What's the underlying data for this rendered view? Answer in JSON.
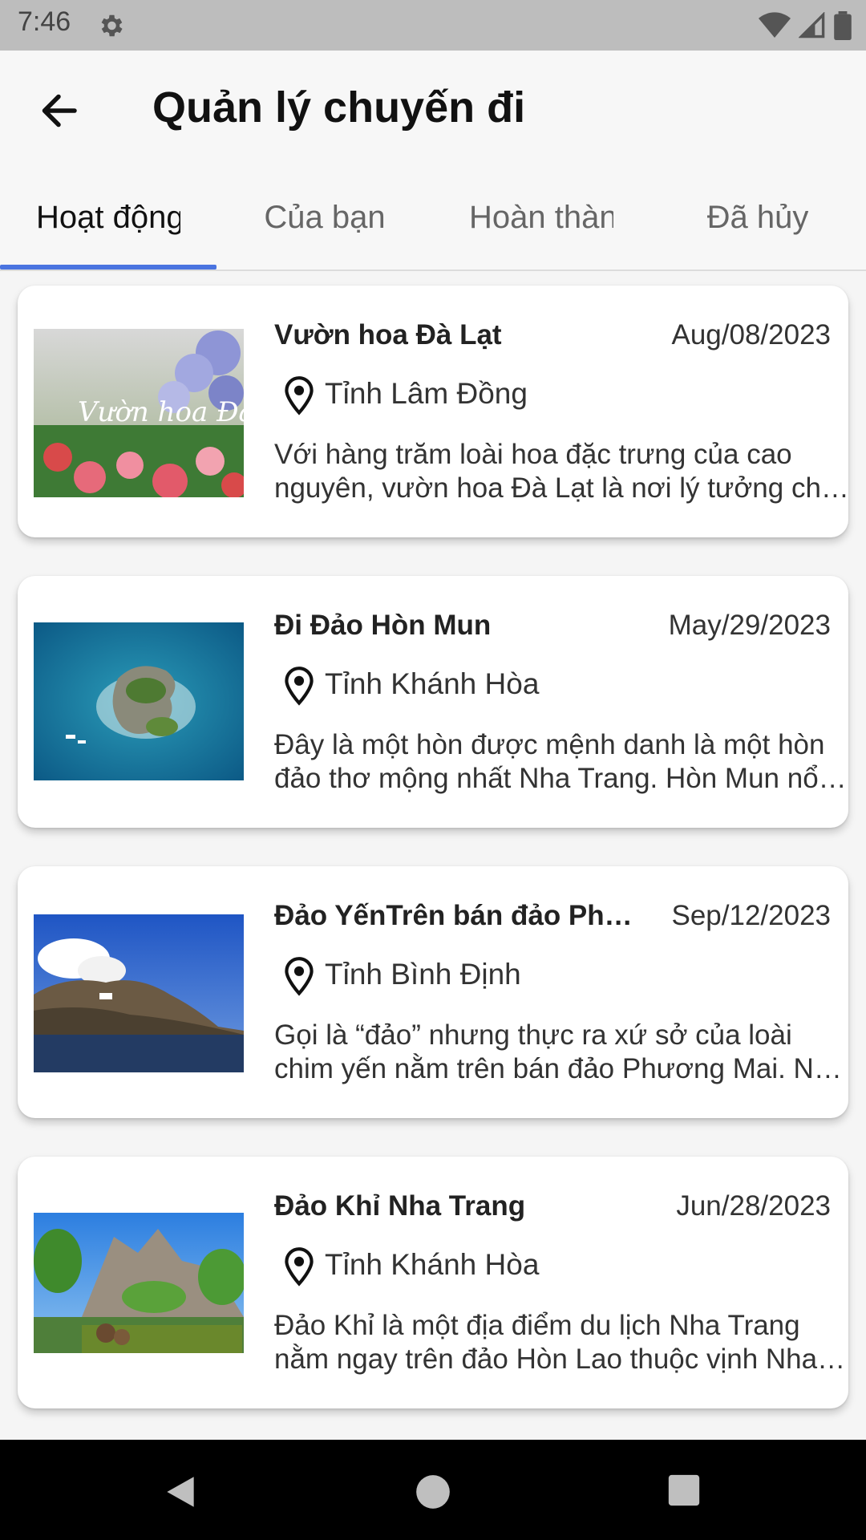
{
  "status_bar": {
    "time": "7:46",
    "icons": [
      "gear-icon",
      "wifi-icon",
      "signal-icon",
      "battery-icon"
    ]
  },
  "app_bar": {
    "title": "Quản lý chuyến đi",
    "back_icon": "arrow-left-icon"
  },
  "tabs": [
    {
      "label": "Hoạt động",
      "active": true
    },
    {
      "label": "Của bạn",
      "active": false
    },
    {
      "label": "Hoàn thành",
      "active": false
    },
    {
      "label": "Đã hủy",
      "active": false
    }
  ],
  "trips": [
    {
      "name": "Vườn hoa Đà Lạt",
      "date": "Aug/08/2023",
      "province": "Tỉnh Lâm Đồng",
      "description": "Với hàng trăm loài hoa đặc trưng của cao nguyên, vườn hoa Đà Lạt là nơi lý tưởng cho du khách tham quan.",
      "image_overlay_text": "Vườn hoa Đà Lạt"
    },
    {
      "name": "Đi Đảo Hòn Mun",
      "date": "May/29/2023",
      "province": "Tỉnh Khánh Hòa",
      "description": "Đây là một hòn được mệnh danh là một hòn đảo thơ mộng nhất Nha Trang. Hòn Mun nổi tiếng với rạn san hô."
    },
    {
      "name": "Đảo YếnTrên bán đảo Phương Mai",
      "date": "Sep/12/2023",
      "province": "Tỉnh Bình Định",
      "description": "Gọi là “đảo” nhưng thực ra xứ sở của loài chim yến nằm trên bán đảo Phương Mai. Nơi đây có cảnh quan hoang sơ."
    },
    {
      "name": "Đảo Khỉ Nha Trang",
      "date": "Jun/28/2023",
      "province": "Tỉnh Khánh Hòa",
      "description": "Đảo Khỉ là một địa điểm du lịch Nha Trang nằm ngay trên đảo Hòn Lao thuộc vịnh Nha Phu."
    }
  ],
  "nav_bar": {
    "icons": [
      "back-triangle-icon",
      "home-circle-icon",
      "recents-square-icon"
    ]
  },
  "colors": {
    "accent": "#4a74e0",
    "status_bar": "#bdbdbd",
    "background": "#f5f5f5"
  }
}
